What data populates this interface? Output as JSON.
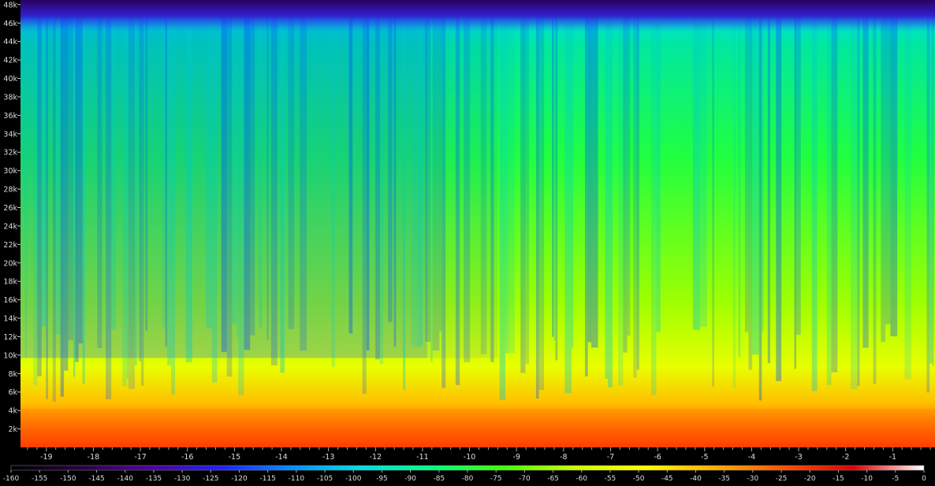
{
  "chart_data": {
    "type": "heatmap",
    "title": "",
    "xlabel": "",
    "ylabel": "",
    "x_ticks": [
      "-19",
      "-18",
      "-17",
      "-16",
      "-15",
      "-14",
      "-13",
      "-12",
      "-11",
      "-10",
      "-9",
      "-8",
      "-7",
      "-6",
      "-5",
      "-4",
      "-3",
      "-2",
      "-1"
    ],
    "x_tick_values": [
      -19,
      -18,
      -17,
      -16,
      -15,
      -14,
      -13,
      -12,
      -11,
      -10,
      -9,
      -8,
      -7,
      -6,
      -5,
      -4,
      -3,
      -2,
      -1
    ],
    "xlim": [
      -19.55,
      -0.1
    ],
    "y_ticks": [
      "2k",
      "4k",
      "6k",
      "8k",
      "10k",
      "12k",
      "14k",
      "16k",
      "18k",
      "20k",
      "22k",
      "24k",
      "26k",
      "28k",
      "30k",
      "32k",
      "34k",
      "36k",
      "38k",
      "40k",
      "42k",
      "44k",
      "46k",
      "48k"
    ],
    "y_tick_values": [
      2000,
      4000,
      6000,
      8000,
      10000,
      12000,
      14000,
      16000,
      18000,
      20000,
      22000,
      24000,
      26000,
      28000,
      30000,
      32000,
      34000,
      36000,
      38000,
      40000,
      42000,
      44000,
      46000,
      48000
    ],
    "ylim": [
      0,
      48500
    ],
    "colorbar": {
      "ticks": [
        "-160",
        "-155",
        "-150",
        "-145",
        "-140",
        "-135",
        "-130",
        "-125",
        "-120",
        "-115",
        "-110",
        "-105",
        "-100",
        "-95",
        "-90",
        "-85",
        "-80",
        "-75",
        "-70",
        "-65",
        "-60",
        "-55",
        "-50",
        "-45",
        "-40",
        "-35",
        "-30",
        "-25",
        "-20",
        "-15",
        "-10",
        "-5",
        "0"
      ],
      "range": [
        -160,
        0
      ],
      "colors": [
        "#000000",
        "#2a0040",
        "#5000a0",
        "#2020ff",
        "#0090ff",
        "#00e0e0",
        "#00ff80",
        "#40ff00",
        "#c8ff00",
        "#ffff00",
        "#ffb000",
        "#ff5000",
        "#e00000",
        "#ffffff"
      ]
    },
    "regions": [
      {
        "x_from": -19.55,
        "x_to": -10.9,
        "level": "lower"
      },
      {
        "x_from": -10.9,
        "x_to": -9.4,
        "level": "transition"
      },
      {
        "x_from": -9.4,
        "x_to": -0.1,
        "level": "higher"
      }
    ],
    "grid": false,
    "legend": "bottom"
  }
}
